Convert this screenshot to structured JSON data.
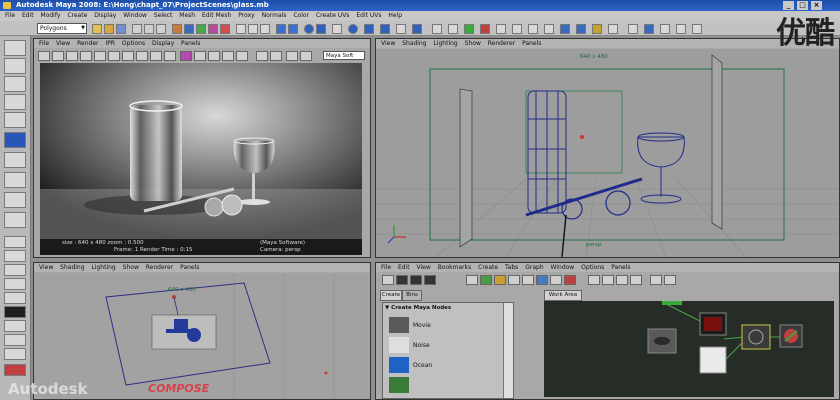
{
  "window": {
    "title": "Autodesk Maya 2008: E:\\Hong\\chapt_07\\ProjectScenes\\glass.mb   ",
    "buttons": [
      "_",
      "□",
      "×"
    ]
  },
  "menubar": {
    "items": [
      "File",
      "Edit",
      "Modify",
      "Create",
      "Display",
      "Window",
      "Select",
      "Mesh",
      "Edit Mesh",
      "Proxy",
      "Normals",
      "Color",
      "Create UVs",
      "Edit UVs",
      "Help"
    ]
  },
  "status_line": {
    "mode": "Polygons"
  },
  "render_view": {
    "menu": [
      "File",
      "View",
      "Render",
      "IPR",
      "Options",
      "Display",
      "Panels"
    ],
    "camera_dropdown": "Maya Soft",
    "stats": [
      "size :   640 x 480  zoom : 0.500",
      "(Maya Software)",
      "Frame: 1    Render Time : 0:15",
      "Camera: persp"
    ]
  },
  "persp_view": {
    "menu": [
      "View",
      "Shading",
      "Lighting",
      "Show",
      "Renderer",
      "Panels"
    ],
    "resolution_gate": "640 x 480",
    "camera_label": "persp"
  },
  "top_view": {
    "menu": [
      "View",
      "Shading",
      "Lighting",
      "Show",
      "Renderer",
      "Panels"
    ],
    "resolution_gate": "640 x 480"
  },
  "hypershade": {
    "menu": [
      "File",
      "Edit",
      "View",
      "Bookmarks",
      "Create",
      "Tabs",
      "Graph",
      "Window",
      "Options",
      "Panels"
    ],
    "tabs": [
      "Create",
      "Bins"
    ],
    "work_area_tab": "Work Area",
    "section_title": "Create Maya Nodes",
    "nodes": [
      "Movie",
      "Noise",
      "Ocean"
    ]
  },
  "watermarks": {
    "top_right": "优酷",
    "autodesk": "Autodesk",
    "redmap": "COMPOSE"
  }
}
